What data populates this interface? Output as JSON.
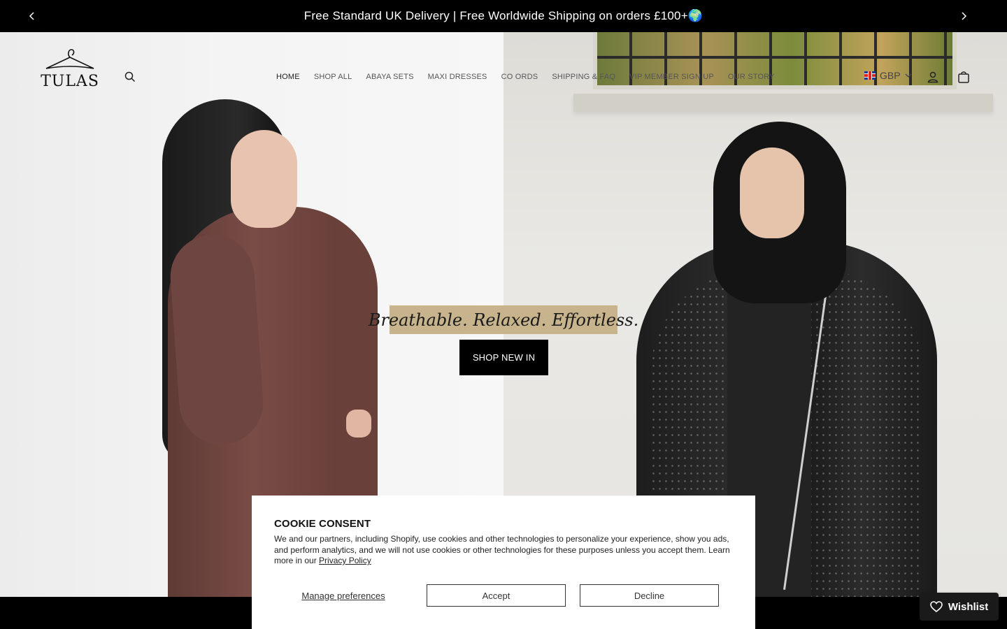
{
  "announcement": {
    "text": "Free Standard UK Delivery | Free Worldwide Shipping on orders £100+🌍"
  },
  "header": {
    "logo_text": "TULAS",
    "nav": [
      "HOME",
      "SHOP ALL",
      "ABAYA SETS",
      "MAXI DRESSES",
      "CO ORDS",
      "SHIPPING & FAQ",
      "VIP MEMBER SIGN UP",
      "OUR STORY"
    ],
    "active_nav": "HOME",
    "currency": "GBP"
  },
  "hero": {
    "tagline": "Breathable. Relaxed. Effortless.",
    "cta": "SHOP NEW IN"
  },
  "cookie": {
    "title": "COOKIE CONSENT",
    "body": "We and our partners, including Shopify, use cookies and other technologies to personalize your experience, show you ads, and perform analytics, and we will not use cookies or other technologies for these purposes unless you accept them. Learn more in our ",
    "link": "Privacy Policy",
    "manage": "Manage preferences",
    "accept": "Accept",
    "decline": "Decline"
  },
  "wishlist": {
    "label": "Wishlist"
  },
  "colors": {
    "announcement_bg": "#000000",
    "tagline_bg": "#c7b38c",
    "cta_bg": "#000000",
    "wishlist_bg": "#1a1a1a"
  },
  "icons": [
    "chevron-left-icon",
    "chevron-right-icon",
    "search-icon",
    "account-icon",
    "bag-icon",
    "heart-icon",
    "uk-flag-icon",
    "chevron-down-icon"
  ]
}
